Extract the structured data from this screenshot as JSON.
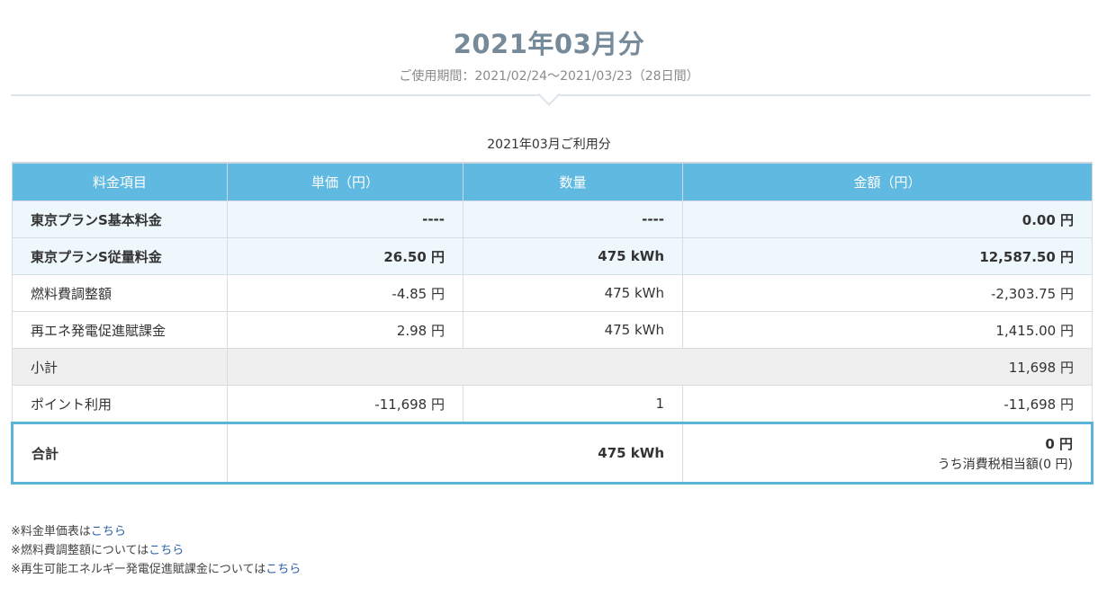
{
  "header": {
    "title": "2021年03月分",
    "period": "ご使用期間：2021/02/24～2021/03/23（28日間）"
  },
  "table": {
    "caption": "2021年03月ご利用分",
    "columns": [
      "料金項目",
      "単価（円）",
      "数量",
      "金額（円）"
    ],
    "rows": [
      {
        "item": "東京プランS基本料金",
        "unit": "----",
        "qty": "----",
        "amount": "0.00 円"
      },
      {
        "item": "東京プランS従量料金",
        "unit": "26.50 円",
        "qty": "475 kWh",
        "amount": "12,587.50 円"
      },
      {
        "item": "燃料費調整額",
        "unit": "-4.85 円",
        "qty": "475 kWh",
        "amount": "-2,303.75 円"
      },
      {
        "item": "再エネ発電促進賦課金",
        "unit": "2.98 円",
        "qty": "475 kWh",
        "amount": "1,415.00 円"
      }
    ],
    "subtotal": {
      "label": "小計",
      "amount": "11,698 円"
    },
    "points": {
      "label": "ポイント利用",
      "unit": "-11,698 円",
      "qty": "1",
      "amount": "-11,698 円"
    },
    "total": {
      "label": "合計",
      "qty": "475 kWh",
      "amount": "0 円",
      "tax": "うち消費税相当額(0 円)"
    }
  },
  "notes": [
    {
      "prefix": "※",
      "text": "料金単価表は",
      "link": "こちら"
    },
    {
      "prefix": "※",
      "text": "燃料費調整額については",
      "link": "こちら"
    },
    {
      "prefix": "※",
      "text": "再生可能エネルギー発電促進賦課金については",
      "link": "こちら"
    }
  ]
}
